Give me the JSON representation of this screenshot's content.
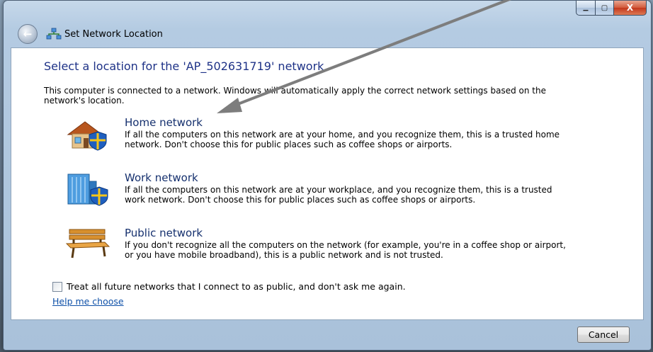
{
  "window": {
    "title": "Set Network Location",
    "minimize_glyph": "▁",
    "maximize_glyph": "▢",
    "close_glyph": "X"
  },
  "page": {
    "heading": "Select a location for the 'AP_502631719' network",
    "intro": "This computer is connected to a network. Windows will automatically apply the correct network settings based on the network's location."
  },
  "options": [
    {
      "title": "Home network",
      "description": "If all the computers on this network are at your home, and you recognize them, this is a trusted home network.  Don't choose this for public places such as coffee shops or airports.",
      "icon": "house-shield-icon"
    },
    {
      "title": "Work network",
      "description": "If all the computers on this network are at your workplace, and you recognize them, this is a trusted work network.  Don't choose this for public places such as coffee shops or airports.",
      "icon": "building-shield-icon"
    },
    {
      "title": "Public network",
      "description": "If you don't recognize all the computers on the network (for example, you're in a coffee shop or airport, or you have mobile broadband), this is a public network and is not trusted.",
      "icon": "park-bench-icon"
    }
  ],
  "checkbox": {
    "label": "Treat all future networks that I connect to as public, and don't ask me again.",
    "checked": false
  },
  "help_link": "Help me choose",
  "footer": {
    "cancel_label": "Cancel"
  },
  "colors": {
    "heading": "#1e3287",
    "option_title": "#15306e",
    "link": "#0e50a8",
    "annotation_arrow": "#7d7d7d"
  }
}
